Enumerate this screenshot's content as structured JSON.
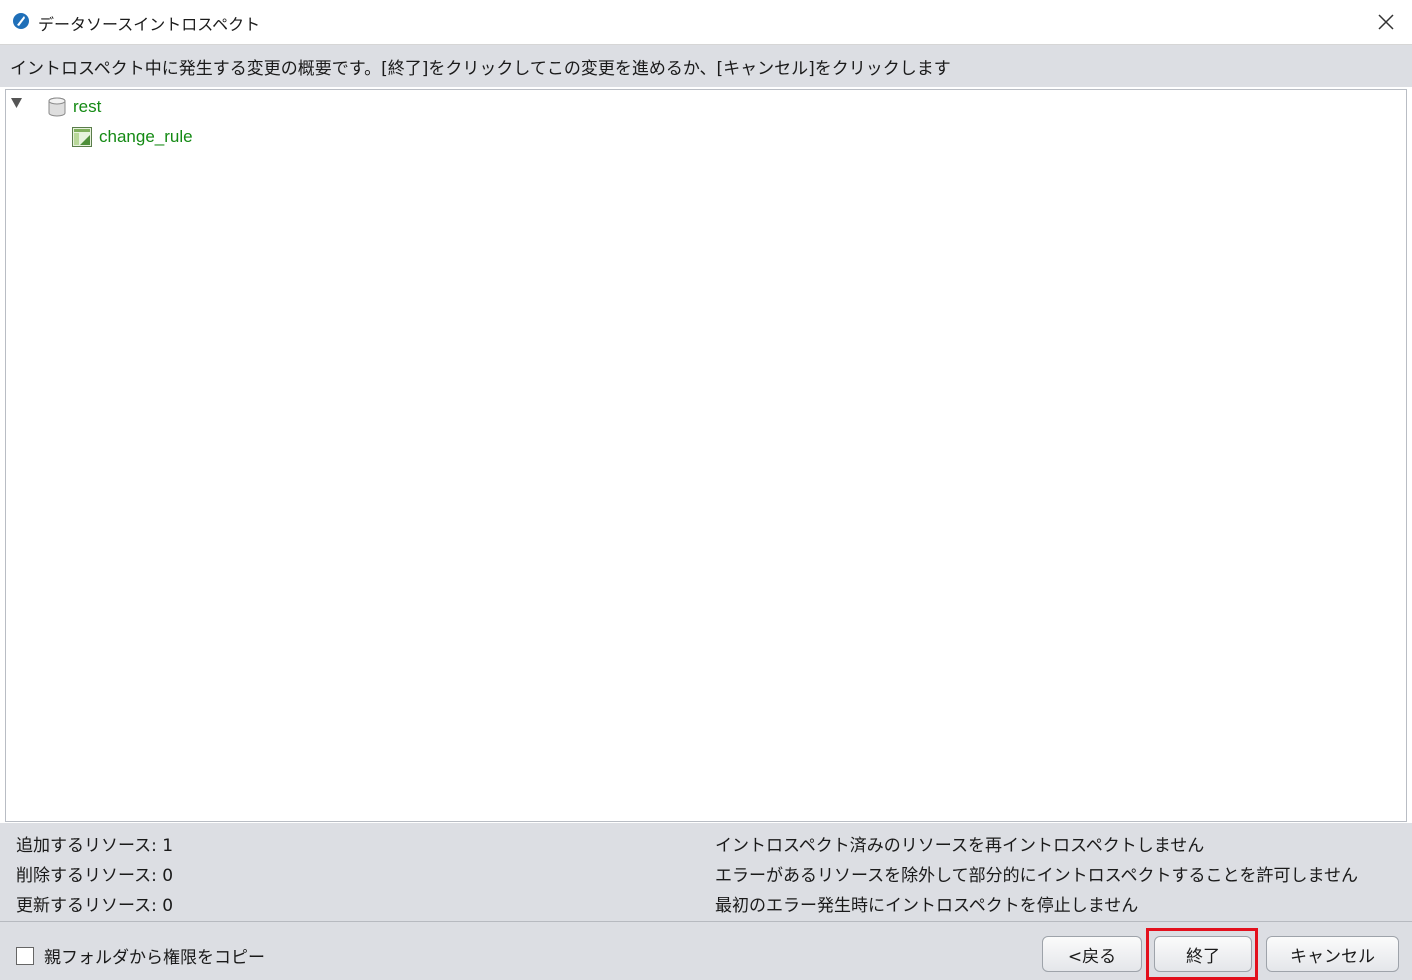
{
  "window": {
    "title": "データソースイントロスペクト",
    "icon": "app-icon",
    "close_icon": "close-icon"
  },
  "instruction": "イントロスペクト中に発生する変更の概要です。[終了]をクリックしてこの変更を進めるか、[キャンセル]をクリックします",
  "tree": {
    "root": {
      "label": "rest",
      "icon": "database-icon",
      "expanded": true
    },
    "children": [
      {
        "label": "change_rule",
        "icon": "table-icon"
      }
    ]
  },
  "stats": {
    "add": "追加するリソース: 1",
    "delete": "削除するリソース: 0",
    "update": "更新するリソース: 0"
  },
  "options": {
    "no_reintrospect": "イントロスペクト済みのリソースを再イントロスペクトしません",
    "no_partial": "エラーがあるリソースを除外して部分的にイントロスペクトすることを許可しません",
    "no_stop_on_error": "最初のエラー発生時にイントロスペクトを停止しません"
  },
  "copy_permissions": {
    "label": "親フォルダから権限をコピー",
    "checked": false
  },
  "buttons": {
    "back": "<戻る",
    "finish": "終了",
    "cancel": "キャンセル"
  },
  "colors": {
    "tree_label": "#148a14",
    "highlight": "#e3101d",
    "panel_bg": "#dcdee3"
  }
}
